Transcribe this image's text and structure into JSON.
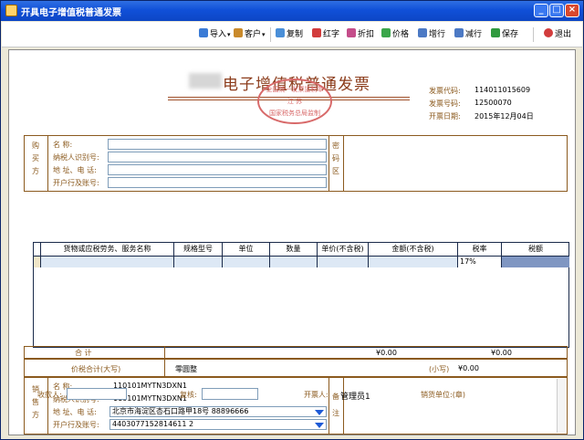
{
  "window": {
    "title": "开具电子增值税普通发票",
    "min": "_",
    "max": "□",
    "close": "×"
  },
  "toolbar": {
    "import": "导入",
    "customer": "客户",
    "copy": "复制",
    "red": "红字",
    "discount": "折扣",
    "price": "价格",
    "add_row": "增行",
    "del_row": "减行",
    "save": "保存",
    "exit": "退出"
  },
  "invoice": {
    "title": "电子增值税普通发票",
    "seal": {
      "line1": "全国统一发票监制章",
      "line2": "江 苏",
      "line3": "国家税务总局监制"
    },
    "code_label": "发票代码:",
    "code": "114011015609",
    "number_label": "发票号码:",
    "number": "12500070",
    "date_label": "开票日期:",
    "date": "2015年12月04日"
  },
  "buyer": {
    "side_label": "购买方",
    "name_label": "名      称:",
    "tax_label": "纳税人识别号:",
    "addr_label": "地 址、电 话:",
    "bank_label": "开户行及账号:",
    "name": "",
    "tax": "",
    "addr": "",
    "bank": ""
  },
  "cipher": {
    "label": "密码区"
  },
  "grid": {
    "headers": [
      "货物或应税劳务、服务名称",
      "规格型号",
      "单位",
      "数量",
      "单价(不含税)",
      "金额(不含税)",
      "税率",
      "税额"
    ],
    "row": {
      "name": "",
      "spec": "",
      "unit": "",
      "qty": "",
      "price": "",
      "amount": "",
      "rate": "17%",
      "tax": ""
    }
  },
  "totals": {
    "sum_label": "合    计",
    "sum_amount": "¥0.00",
    "sum_tax": "¥0.00",
    "grand_label": "价税合计(大写)",
    "grand_upper": "零圆整",
    "small_label": "(小写)",
    "grand_lower": "¥0.00"
  },
  "seller": {
    "side_label": "销售方",
    "name_label": "名      称:",
    "tax_label": "纳税人识别号:",
    "addr_label": "地 址、电 话:",
    "bank_label": "开户行及账号:",
    "name": "110101MYTN3DXN1",
    "tax": "110101MYTN3DXN1",
    "addr": "北京市海淀区杏石口路甲18号 88896666",
    "bank": "4403077152814611 2"
  },
  "remark": {
    "label": "备注"
  },
  "footer": {
    "payee_label": "收款人:",
    "payee": "",
    "review_label": "复核:",
    "review": "",
    "drawer_label": "开票人:",
    "drawer": "管理员1",
    "seller_seal": "销货单位:(章)"
  }
}
